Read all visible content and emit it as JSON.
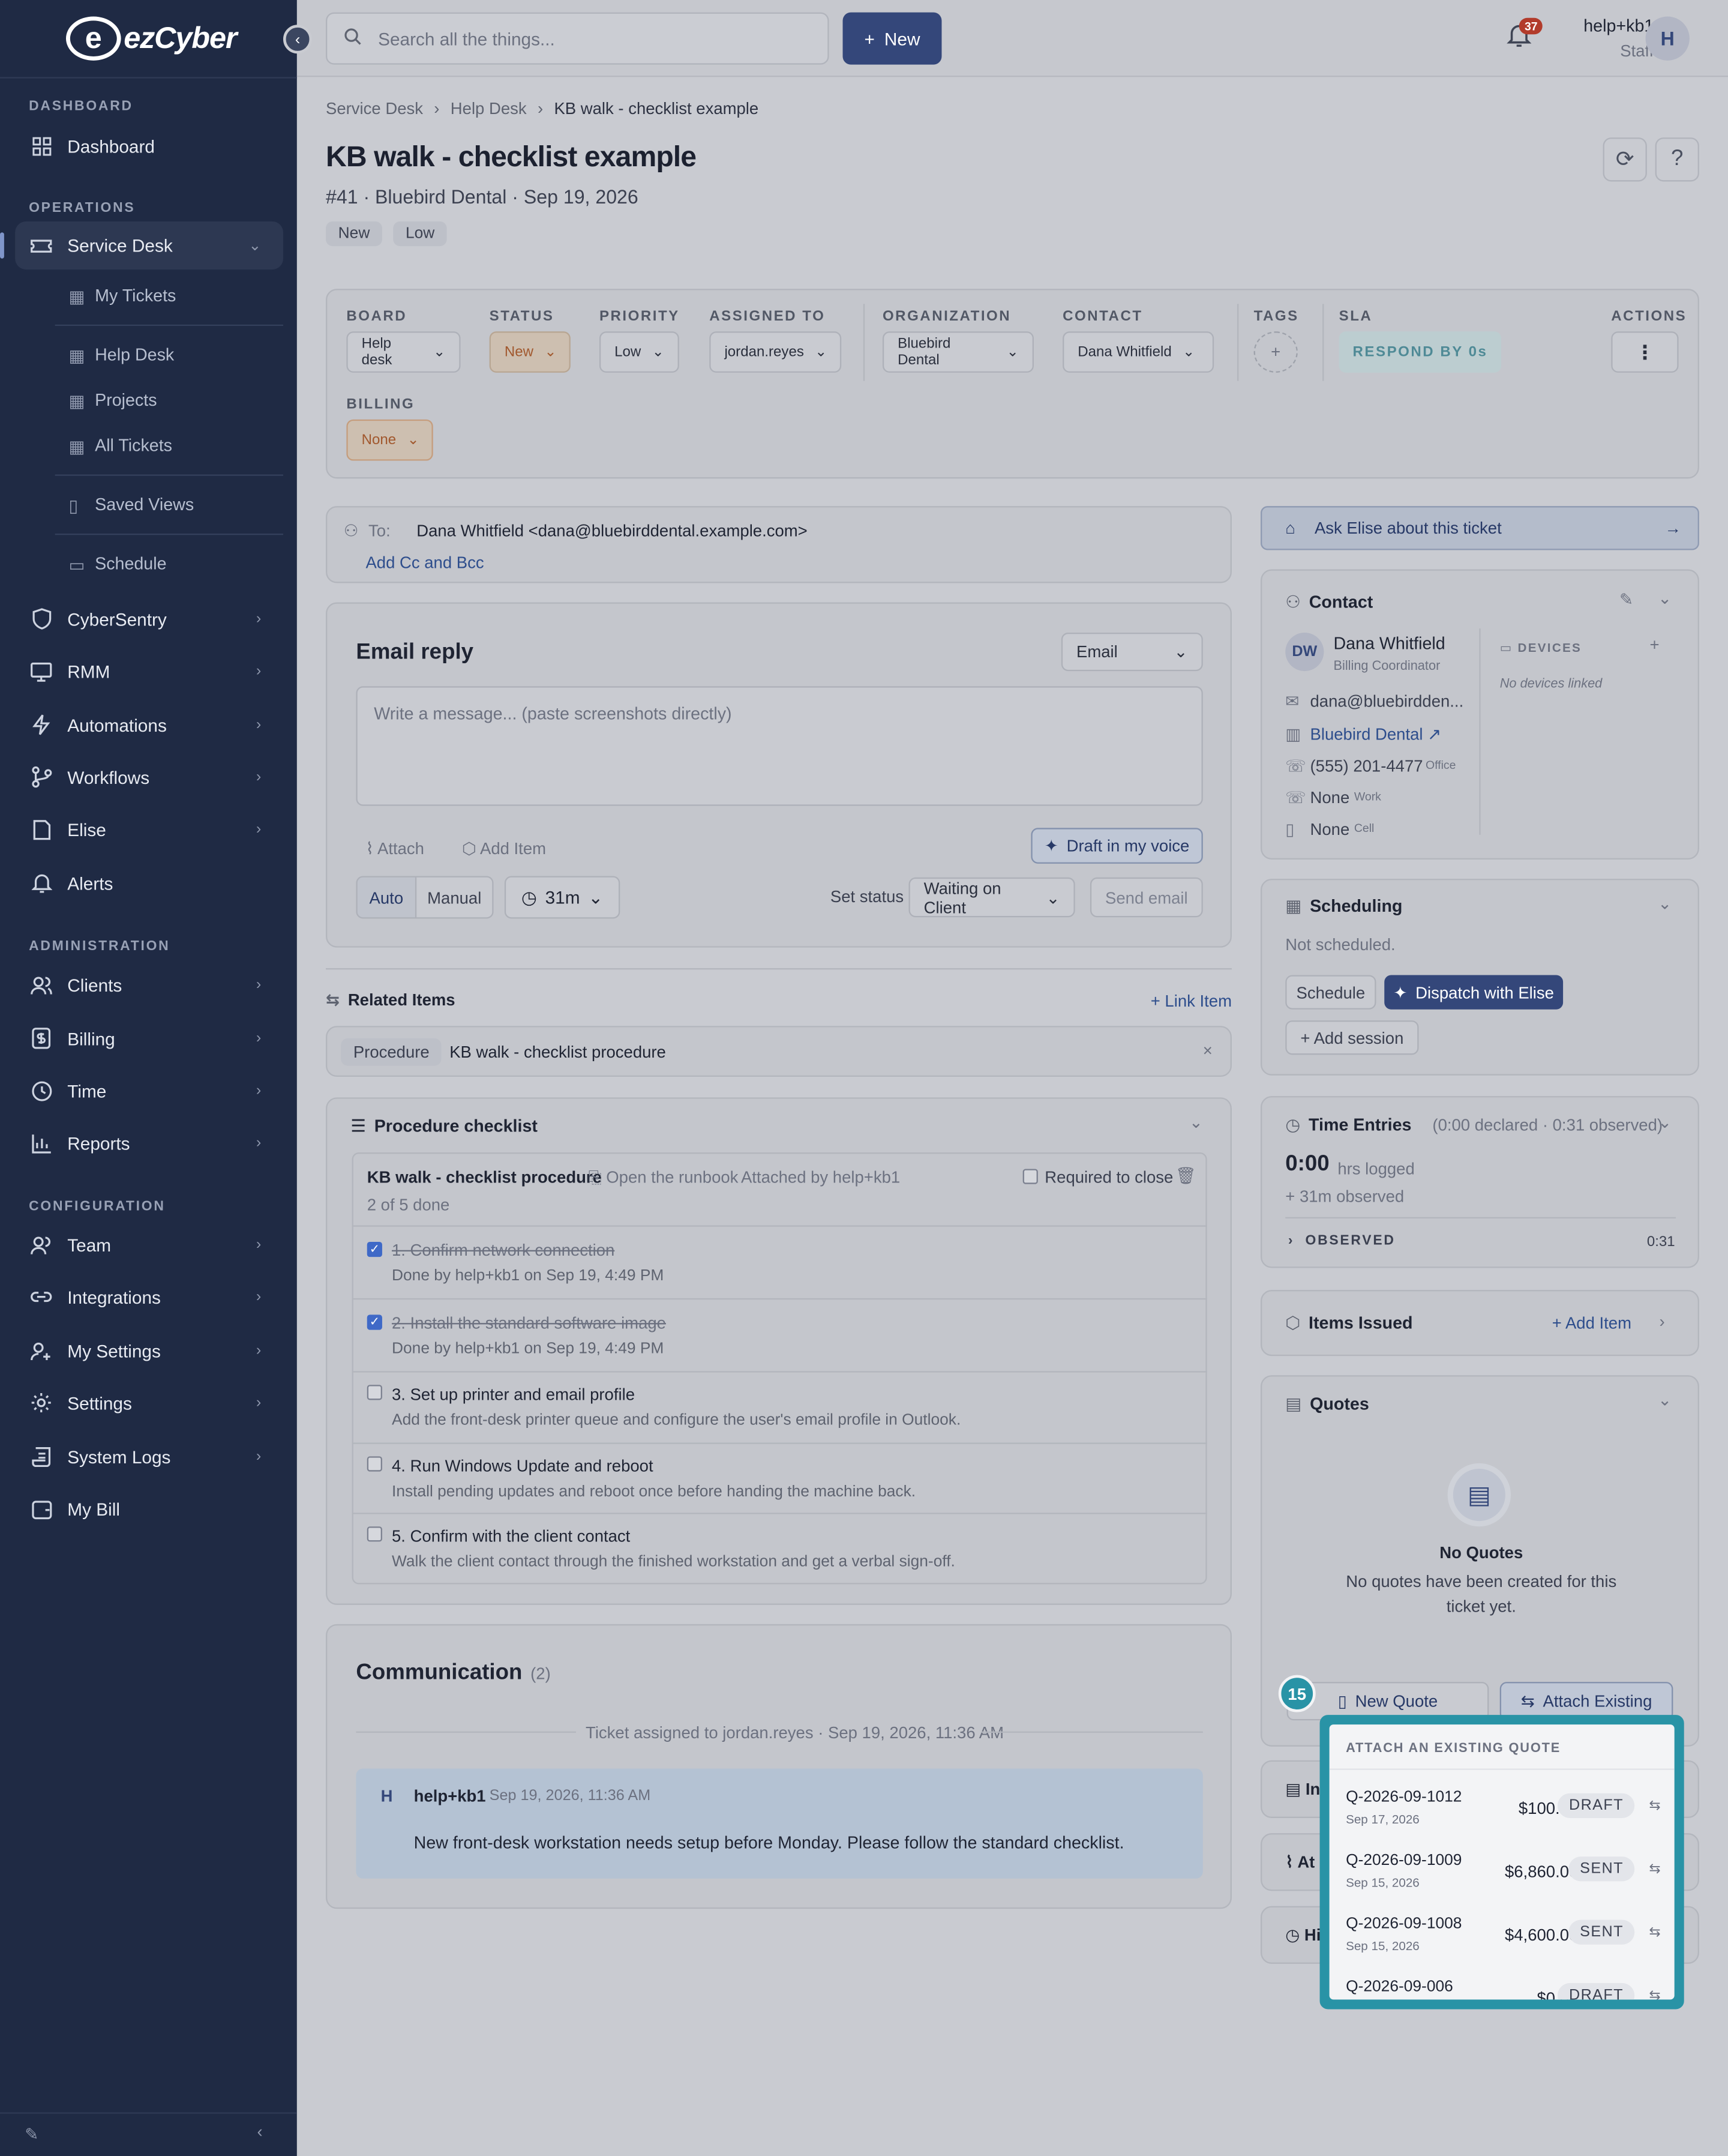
{
  "brand": {
    "name": "ezCyber"
  },
  "sidebar": {
    "sections": [
      {
        "label": "DASHBOARD"
      },
      {
        "label": "OPERATIONS"
      },
      {
        "label": "ADMINISTRATION"
      },
      {
        "label": "CONFIGURATION"
      }
    ],
    "dashboard": "Dashboard",
    "service_desk": "Service Desk",
    "sub_items": [
      "My Tickets",
      "Help Desk",
      "Projects",
      "All Tickets",
      "Saved Views",
      "Schedule"
    ],
    "ops_items": [
      "CyberSentry",
      "RMM",
      "Automations",
      "Workflows",
      "Elise",
      "Alerts"
    ],
    "admin_items": [
      "Clients",
      "Billing",
      "Time",
      "Reports"
    ],
    "config_items": [
      "Team",
      "Integrations",
      "My Settings",
      "Settings",
      "System Logs",
      "My Bill"
    ]
  },
  "topbar": {
    "search_placeholder": "Search all the things...",
    "new_label": "New",
    "notif_count": "37",
    "user_name": "help+kb1",
    "user_role": "Staff",
    "avatar_initial": "H"
  },
  "breadcrumbs": [
    "Service Desk",
    "Help Desk",
    "KB walk - checklist example"
  ],
  "ticket": {
    "title": "KB walk - checklist example",
    "subtitle": "#41 · Bluebird Dental · Sep 19, 2026",
    "chips": [
      "New",
      "Low"
    ]
  },
  "fields": {
    "board": {
      "label": "BOARD",
      "value": "Help desk"
    },
    "status": {
      "label": "STATUS",
      "value": "New"
    },
    "priority": {
      "label": "PRIORITY",
      "value": "Low"
    },
    "assigned": {
      "label": "ASSIGNED TO",
      "value": "jordan.reyes"
    },
    "organization": {
      "label": "ORGANIZATION",
      "value": "Bluebird Dental"
    },
    "contact": {
      "label": "CONTACT",
      "value": "Dana Whitfield"
    },
    "tags": {
      "label": "TAGS"
    },
    "sla": {
      "label": "SLA",
      "value": "RESPOND BY 0s"
    },
    "actions": {
      "label": "ACTIONS"
    },
    "billing": {
      "label": "BILLING",
      "value": "None"
    }
  },
  "recipients": {
    "to_label": "To:",
    "to_value": "Dana Whitfield <dana@bluebirddental.example.com>",
    "add_cc": "Add Cc and Bcc"
  },
  "email_reply": {
    "title": "Email reply",
    "channel": "Email",
    "placeholder": "Write a message... (paste screenshots directly)",
    "attach": "Attach",
    "add_item": "Add Item",
    "draft": "Draft in my voice",
    "auto": "Auto",
    "manual": "Manual",
    "timer": "31m",
    "set_status_label": "Set status",
    "status_value": "Waiting on Client",
    "send": "Send email"
  },
  "related": {
    "title": "Related Items",
    "link_item": "+ Link Item",
    "type": "Procedure",
    "name": "KB walk - checklist procedure"
  },
  "checklist": {
    "title": "Procedure checklist",
    "procedure": "KB walk - checklist procedure",
    "runbook": "Open the runbook",
    "attached_by": "Attached by help+kb1",
    "required": "Required to close",
    "progress": "2 of 5 done",
    "items": [
      {
        "title": "1. Confirm network connection",
        "desc": "Done by help+kb1 on Sep 19, 4:49 PM",
        "done": true
      },
      {
        "title": "2. Install the standard software image",
        "desc": "Done by help+kb1 on Sep 19, 4:49 PM",
        "done": true
      },
      {
        "title": "3. Set up printer and email profile",
        "desc": "Add the front-desk printer queue and configure the user's email profile in Outlook.",
        "done": false
      },
      {
        "title": "4. Run Windows Update and reboot",
        "desc": "Install pending updates and reboot once before handing the machine back.",
        "done": false
      },
      {
        "title": "5. Confirm with the client contact",
        "desc": "Walk the client contact through the finished workstation and get a verbal sign-off.",
        "done": false
      }
    ]
  },
  "communication": {
    "title": "Communication",
    "count": "(2)",
    "event": "Ticket assigned to jordan.reyes · Sep 19, 2026, 11:36 AM",
    "msg_initial": "H",
    "msg_author": "help+kb1",
    "msg_time": "Sep 19, 2026, 11:36 AM",
    "msg_body": "New front-desk workstation needs setup before Monday. Please follow the standard checklist."
  },
  "right": {
    "ask_elise": "Ask Elise about this ticket",
    "contact_title": "Contact",
    "contact_initials": "DW",
    "contact_name": "Dana Whitfield",
    "contact_role": "Billing Coordinator",
    "contact_email": "dana@bluebirdden...",
    "contact_org": "Bluebird Dental",
    "phone_office": "(555) 201-4477",
    "phone_office_label": "Office",
    "phone_work": "None",
    "phone_work_label": "Work",
    "phone_cell": "None",
    "phone_cell_label": "Cell",
    "devices_label": "DEVICES",
    "no_devices": "No devices linked",
    "scheduling_title": "Scheduling",
    "not_scheduled": "Not scheduled.",
    "schedule_btn": "Schedule",
    "dispatch_btn": "Dispatch with Elise",
    "add_session": "+ Add session",
    "time_title": "Time Entries",
    "time_summary": "(0:00 declared · 0:31 observed)",
    "hrs": "0:00",
    "hrs_label": "hrs logged",
    "observed_line": "+ 31m observed",
    "observed_label": "OBSERVED",
    "observed_value": "0:31",
    "items_issued": "Items Issued",
    "add_item": "+ Add Item",
    "quotes_title": "Quotes",
    "no_quotes": "No Quotes",
    "no_quotes_desc": "No quotes have been created for this ticket yet.",
    "new_quote": "New Quote",
    "attach_existing": "Attach Existing",
    "hidden_a": "In",
    "hidden_b": "At",
    "hidden_c": "Hi"
  },
  "popover": {
    "step": "15",
    "header": "ATTACH AN EXISTING QUOTE",
    "quotes": [
      {
        "id": "Q-2026-09-1012",
        "date": "Sep 17, 2026",
        "amount": "$100.00",
        "status": "DRAFT"
      },
      {
        "id": "Q-2026-09-1009",
        "date": "Sep 15, 2026",
        "amount": "$6,860.00",
        "status": "SENT"
      },
      {
        "id": "Q-2026-09-1008",
        "date": "Sep 15, 2026",
        "amount": "$4,600.00",
        "status": "SENT"
      },
      {
        "id": "Q-2026-09-006",
        "date": "",
        "amount": "$0.00",
        "status": "DRAFT"
      }
    ]
  },
  "colors": {
    "sidebar": "#1f2a44",
    "primary": "#34477a",
    "highlight": "#2993a6",
    "status_orange": "#a1582e"
  }
}
